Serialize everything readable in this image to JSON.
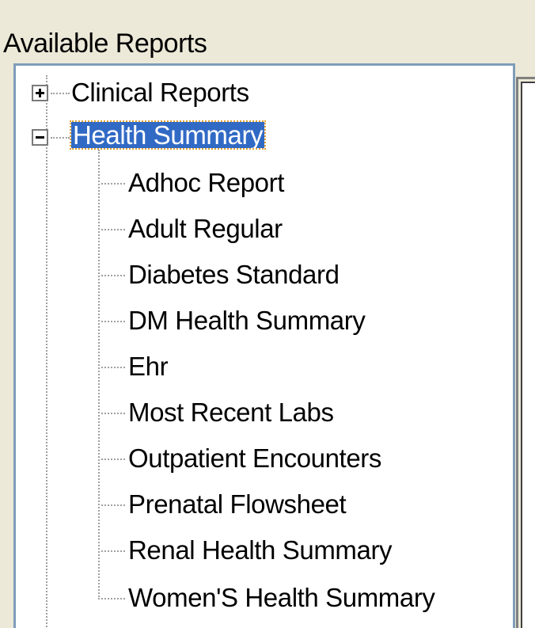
{
  "panel": {
    "title": "Available Reports"
  },
  "tree": {
    "clinical_reports": {
      "label": "Clinical Reports",
      "state": "collapsed",
      "expander_icon": "plus"
    },
    "health_summary": {
      "label": "Health Summary",
      "state": "expanded",
      "selected": true,
      "expander_icon": "minus",
      "children": [
        "Adhoc Report",
        "Adult Regular",
        "Diabetes Standard",
        "DM Health Summary",
        "Ehr",
        "Most Recent Labs",
        "Outpatient Encounters",
        "Prenatal Flowsheet",
        "Renal Health Summary",
        "Women'S Health Summary"
      ]
    }
  },
  "colors": {
    "window_bg": "#ECE9D8",
    "tree_bg": "#FFFFFF",
    "tree_border": "#7F9DB9",
    "selection_bg": "#316AC5",
    "selection_text": "#FFFFFF",
    "focus_outline": "#E0A030"
  }
}
